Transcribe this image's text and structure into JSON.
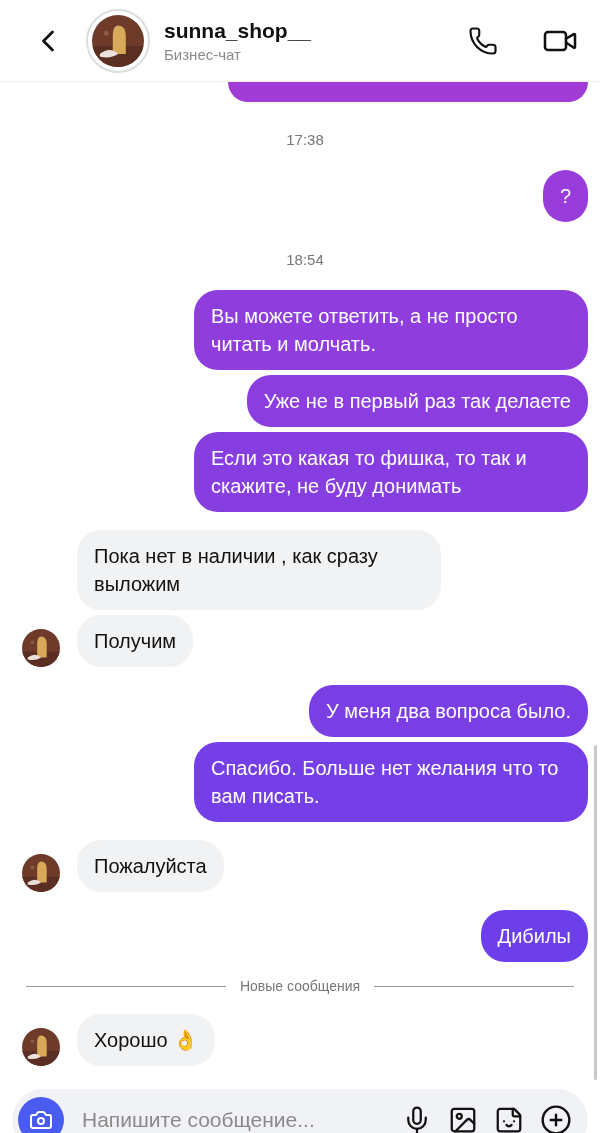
{
  "header": {
    "name": "sunna_shop__",
    "subtitle": "Бизнес-чат"
  },
  "messages": [
    {
      "kind": "sent_cut"
    },
    {
      "kind": "time",
      "text": "17:38"
    },
    {
      "kind": "sent",
      "text": "?"
    },
    {
      "kind": "time",
      "text": "18:54"
    },
    {
      "kind": "sent",
      "text": "Вы можете ответить, а не просто читать и молчать."
    },
    {
      "kind": "sent",
      "text": "Уже не в первый раз так делаете"
    },
    {
      "kind": "sent",
      "text": "Если это какая то фишка, то так и скажите, не буду донимать"
    },
    {
      "kind": "received",
      "text": "Пока нет в наличии , как сразу выложим",
      "avatar": false
    },
    {
      "kind": "received",
      "text": "Получим",
      "avatar": true
    },
    {
      "kind": "sent",
      "text": "У меня два вопроса было."
    },
    {
      "kind": "sent",
      "text": "Спасибо. Больше нет желания что то вам писать."
    },
    {
      "kind": "received",
      "text": "Пожалуйста",
      "avatar": true
    },
    {
      "kind": "sent",
      "text": "Дибилы"
    },
    {
      "kind": "divider",
      "text": "Новые сообщения"
    },
    {
      "kind": "received",
      "text": "Хорошо 👌",
      "avatar": true
    }
  ],
  "composer": {
    "placeholder": "Напишите сообщение..."
  }
}
